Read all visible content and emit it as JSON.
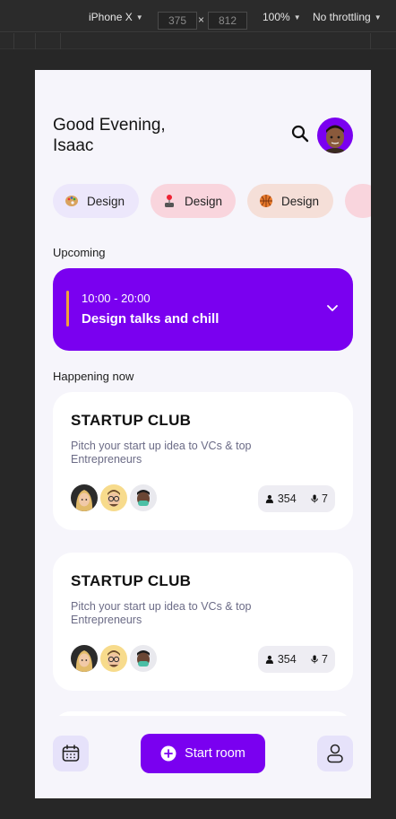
{
  "devtools": {
    "device": "iPhone X",
    "width": "375",
    "height": "812",
    "zoom": "100%",
    "throttling": "No throttling"
  },
  "header": {
    "greeting": "Good Evening,\nIsaac"
  },
  "categories": [
    {
      "label": "Design",
      "icon": "palette-icon"
    },
    {
      "label": "Design",
      "icon": "joystick-icon"
    },
    {
      "label": "Design",
      "icon": "basketball-icon"
    },
    {
      "label": "",
      "icon": "joystick-icon"
    }
  ],
  "upcoming": {
    "label": "Upcoming",
    "time": "10:00 - 20:00",
    "title": "Design talks and chill"
  },
  "happening": {
    "label": "Happening now",
    "rooms": [
      {
        "title": "STARTUP CLUB",
        "description": "Pitch your start up idea to VCs & top Entrepreneurs",
        "listeners": "354",
        "speakers": "7"
      },
      {
        "title": "STARTUP CLUB",
        "description": "Pitch your start up idea to VCs & top Entrepreneurs",
        "listeners": "354",
        "speakers": "7"
      }
    ]
  },
  "bottom_bar": {
    "start_label": "Start room"
  },
  "colors": {
    "accent": "#7a00f0",
    "highlight": "#f0a13a",
    "background": "#f6f5fb"
  }
}
